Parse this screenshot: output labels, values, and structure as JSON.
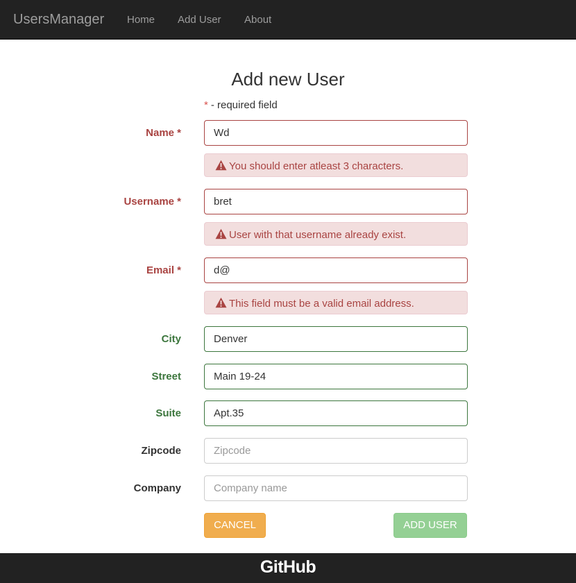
{
  "navbar": {
    "brand": "UsersManager",
    "links": [
      "Home",
      "Add User",
      "About"
    ]
  },
  "form": {
    "title": "Add new User",
    "required_star": "*",
    "required_note": "- required field",
    "fields": [
      {
        "label": "Name *",
        "value": "Wd",
        "placeholder": "",
        "state": "error",
        "error": "You should enter atleast 3 characters."
      },
      {
        "label": "Username *",
        "value": "bret",
        "placeholder": "",
        "state": "error",
        "error": "User with that username already exist."
      },
      {
        "label": "Email *",
        "value": "d@",
        "placeholder": "",
        "state": "error",
        "error": "This field must be a valid email address."
      },
      {
        "label": "City",
        "value": "Denver",
        "placeholder": "",
        "state": "valid"
      },
      {
        "label": "Street",
        "value": "Main 19-24",
        "placeholder": "",
        "state": "valid"
      },
      {
        "label": "Suite",
        "value": "Apt.35",
        "placeholder": "",
        "state": "valid"
      },
      {
        "label": "Zipcode",
        "value": "",
        "placeholder": "Zipcode",
        "state": "neutral"
      },
      {
        "label": "Company",
        "value": "",
        "placeholder": "Company name",
        "state": "neutral"
      }
    ],
    "cancel_label": "CANCEL",
    "submit_label": "ADD USER"
  },
  "footer": {
    "brand": "GitHub"
  },
  "colors": {
    "navbar": "#222222",
    "error": "#a94442",
    "error_bg": "#f2dede",
    "valid": "#3c763d",
    "cancel": "#f0ad4e",
    "submit": "#5cb85c"
  },
  "icons": {
    "alert": "warning-icon"
  }
}
